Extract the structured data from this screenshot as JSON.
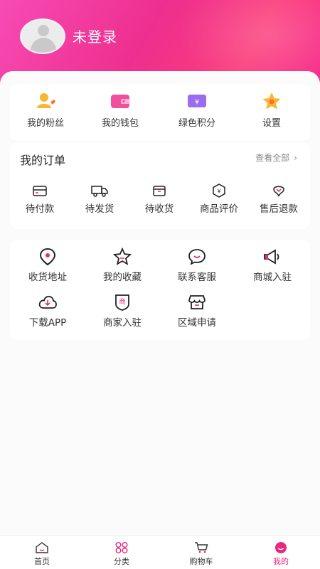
{
  "profile": {
    "login_status": "未登录"
  },
  "quick_actions": [
    {
      "label": "我的粉丝",
      "icon": "fans-icon"
    },
    {
      "label": "我的钱包",
      "icon": "wallet-icon"
    },
    {
      "label": "绿色积分",
      "icon": "points-icon"
    },
    {
      "label": "设置",
      "icon": "settings-star-icon"
    }
  ],
  "orders": {
    "title": "我的订单",
    "view_all": "查看全部",
    "items": [
      {
        "label": "待付款",
        "icon": "card-icon"
      },
      {
        "label": "待发货",
        "icon": "truck-icon"
      },
      {
        "label": "待收货",
        "icon": "box-icon"
      },
      {
        "label": "商品评价",
        "icon": "review-icon"
      },
      {
        "label": "售后退款",
        "icon": "refund-icon"
      }
    ]
  },
  "services": [
    {
      "label": "收货地址",
      "icon": "location-icon"
    },
    {
      "label": "我的收藏",
      "icon": "star-icon"
    },
    {
      "label": "联系客服",
      "icon": "chat-icon"
    },
    {
      "label": "商城入驻",
      "icon": "megaphone-icon"
    },
    {
      "label": "下载APP",
      "icon": "download-icon"
    },
    {
      "label": "商家入驻",
      "icon": "shop-badge-icon"
    },
    {
      "label": "区域申请",
      "icon": "store-icon"
    }
  ],
  "tabbar": [
    {
      "label": "首页",
      "icon": "home-icon"
    },
    {
      "label": "分类",
      "icon": "category-icon"
    },
    {
      "label": "购物车",
      "icon": "cart-icon"
    },
    {
      "label": "我的",
      "icon": "profile-icon",
      "active": true
    }
  ],
  "colors": {
    "accent": "#e8287d",
    "header_start": "#f74bb4",
    "header_end": "#f6288a"
  }
}
